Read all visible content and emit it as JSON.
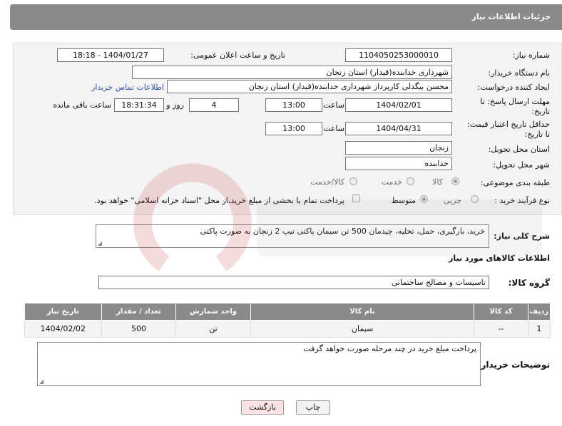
{
  "header": {
    "title": "جزئیات اطلاعات نیاز"
  },
  "form": {
    "need_number_label": "شماره نیاز:",
    "need_number": "1104050253000010",
    "announce_label": "تاریخ و ساعت اعلان عمومی:",
    "announce_value": "1404/01/27 - 18:18",
    "buyer_org_label": "نام دستگاه خریدار:",
    "buyer_org": "شهرداری خدابنده(قیدار) استان زنجان",
    "creator_label": "ایجاد کننده درخواست:",
    "creator": "محسن بیگدلی کارپرداز شهرداری خدابنده(قیدار) استان زنجان",
    "contact_link": "اطلاعات تماس خریدار",
    "deadline_label_1": "مهلت ارسال پاسخ: تا",
    "deadline_label_2": "تاریخ:",
    "deadline_date": "1404/02/01",
    "time_label": "ساعت",
    "deadline_time": "13:00",
    "days_value": "4",
    "days_label": "روز و",
    "remaining_time": "18:31:34",
    "remaining_label": "ساعت باقی مانده",
    "validity_label_1": "حداقل تاریخ اعتبار قیمت:",
    "validity_label_2": "تا تاریخ:",
    "validity_date": "1404/04/31",
    "validity_time": "13:00",
    "province_label": "استان محل تحویل:",
    "province": "زنجان",
    "city_label": "شهر محل تحویل:",
    "city": "خدابنده",
    "category_label": "طبقه بندی موضوعی:",
    "category_options": [
      "کالا",
      "خدمت",
      "کالا/خدمت"
    ],
    "process_label": "نوع فرآیند خرید :",
    "process_options": [
      "جزیی",
      "متوسط"
    ],
    "payment_note": "پرداخت تمام یا بخشی از مبلغ خرید،از محل \"اسناد خزانه اسلامی\" خواهد بود.",
    "description_label": "شرح کلی نیاز:",
    "description": "خرید، بارگیری، حمل، تخلیه، چیدمان 500 تن سیمان پاکتی تیپ 2 زنجان به صورت پاکتی"
  },
  "goods": {
    "section_title": "اطلاعات کالاهای مورد نیاز",
    "group_label": "گروه کالا:",
    "group_value": "تاسیسات و مصالح ساختمانی",
    "columns": [
      "ردیف",
      "کد کالا",
      "نام کالا",
      "واحد شمارش",
      "تعداد / مقدار",
      "تاریخ نیاز"
    ],
    "rows": [
      [
        "1",
        "--",
        "سیمان",
        "تن",
        "500",
        "1404/02/02"
      ]
    ]
  },
  "notes": {
    "label": "توضیحات خریدار:",
    "value": "پرداخت مبلغ خرید در چند مرحله صورت خواهد گرفت"
  },
  "buttons": {
    "print": "چاپ",
    "back": "بازگشت"
  },
  "colors": {
    "header": "#8a8a8a",
    "link": "#2a55a8",
    "back_button": "#fde3e3"
  }
}
